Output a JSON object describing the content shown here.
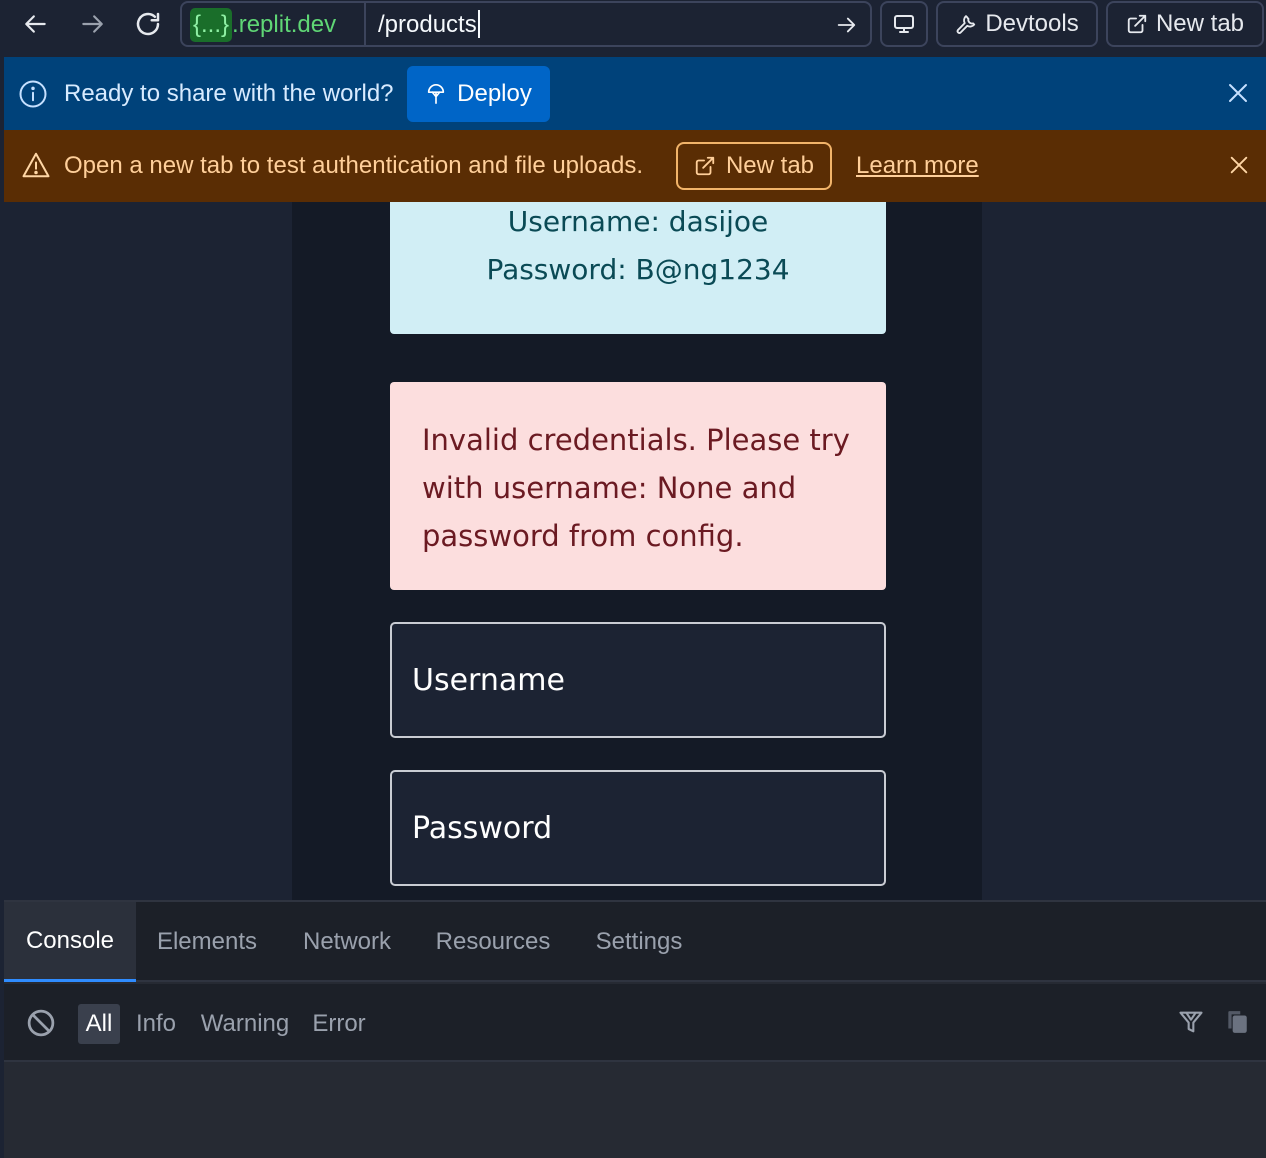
{
  "toolbar": {
    "url_domain_badge": "{...}",
    "url_domain_suffix": ".replit.dev",
    "url_path": "/products",
    "devtools_label": "Devtools",
    "new_tab_label": "New tab"
  },
  "deploy_banner": {
    "message": "Ready to share with the world?",
    "button_label": "Deploy"
  },
  "warning_banner": {
    "message": "Open a new tab to test authentication and file uploads.",
    "new_tab_label": "New tab",
    "learn_more_label": "Learn more"
  },
  "page": {
    "credentials": {
      "username_line": "Username: dasijoe",
      "password_line": "Password: B@ng1234"
    },
    "error_message": "Invalid credentials. Please try with username: None and password from config.",
    "username_placeholder": "Username",
    "password_placeholder": "Password"
  },
  "devtools": {
    "tabs": [
      "Console",
      "Elements",
      "Network",
      "Resources",
      "Settings"
    ],
    "active_tab": "Console",
    "levels": [
      "All",
      "Info",
      "Warning",
      "Error"
    ],
    "active_level": "All"
  },
  "colors": {
    "deploy_banner_bg": "#00427a",
    "warning_banner_bg": "#5a2d04",
    "credentials_bg": "#d1eef5",
    "error_bg": "#fcdede",
    "accent": "#2f8cff"
  },
  "icons": {
    "back": "arrow-left-icon",
    "forward": "arrow-right-icon",
    "reload": "reload-icon",
    "go": "arrow-right-icon",
    "screen": "monitor-icon",
    "devtools": "wrench-icon",
    "new_tab": "external-link-icon",
    "info": "info-icon",
    "deploy": "deploy-icon",
    "close": "close-icon",
    "warning": "warning-icon",
    "clear": "clear-console-icon",
    "filter": "filter-icon",
    "copy": "copy-icon"
  }
}
